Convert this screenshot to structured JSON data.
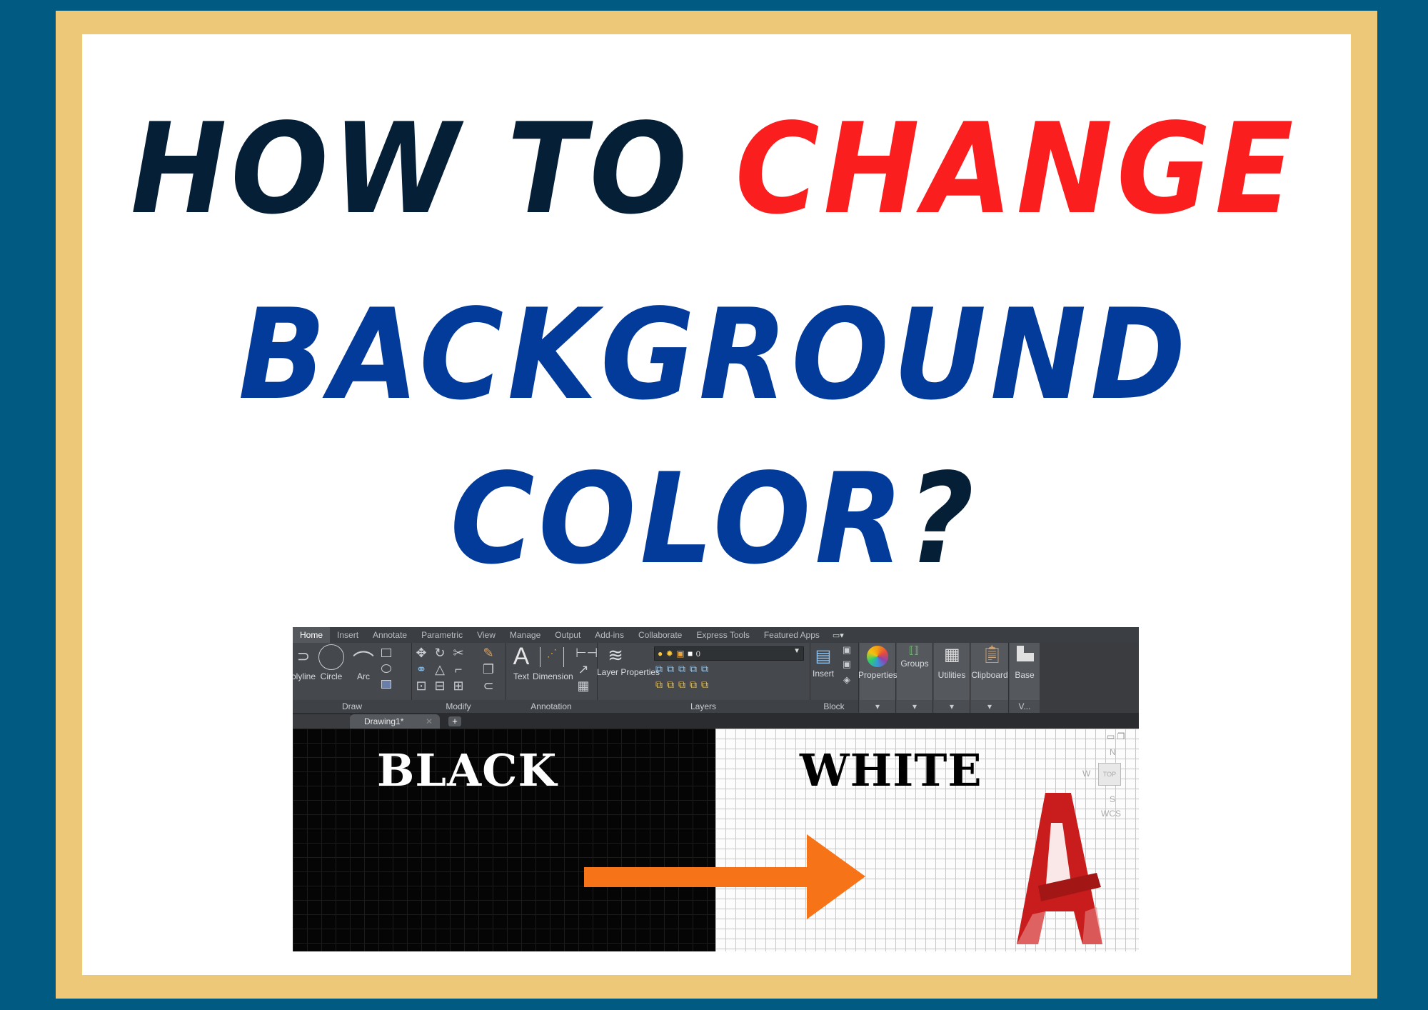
{
  "title": {
    "line1_part1": "HOW TO",
    "line1_part2": "CHANGE",
    "line2": "BACKGROUND",
    "line3_part1": "COLOR",
    "line3_part2": "?"
  },
  "colors": {
    "outer_background": "#005a82",
    "frame": "#ecc878",
    "title_dark": "#051f37",
    "title_red": "#fb1e1e",
    "title_blue": "#033b9b",
    "arrow": "#f77317",
    "logo_red": "#d42020"
  },
  "autocad": {
    "ribbon_tabs": [
      "Home",
      "Insert",
      "Annotate",
      "Parametric",
      "View",
      "Manage",
      "Output",
      "Add-ins",
      "Collaborate",
      "Express Tools",
      "Featured Apps"
    ],
    "panels": {
      "draw": {
        "title": "Draw",
        "tools": [
          "Polyline",
          "Circle",
          "Arc"
        ]
      },
      "modify": {
        "title": "Modify"
      },
      "annotation": {
        "title": "Annotation",
        "tools": [
          "Text",
          "Dimension"
        ]
      },
      "layers": {
        "title": "Layers",
        "tools": [
          "Layer Properties"
        ],
        "current_layer": "0"
      },
      "block": {
        "title": "Block",
        "tools": [
          "Insert"
        ]
      },
      "properties": {
        "title": "Properties"
      },
      "groups": {
        "title": "Groups"
      },
      "utilities": {
        "title": "Utilities"
      },
      "clipboard": {
        "title": "Clipboard"
      },
      "view": {
        "title": "V...",
        "tools": [
          "Base"
        ]
      }
    },
    "drawing_tab": "Drawing1*",
    "new_tab": "+",
    "viewcube": {
      "top": "TOP",
      "n": "N",
      "s": "S",
      "w": "W",
      "wcs": "WCS"
    }
  },
  "comparison": {
    "left_label": "BLACK",
    "right_label": "WHITE"
  }
}
